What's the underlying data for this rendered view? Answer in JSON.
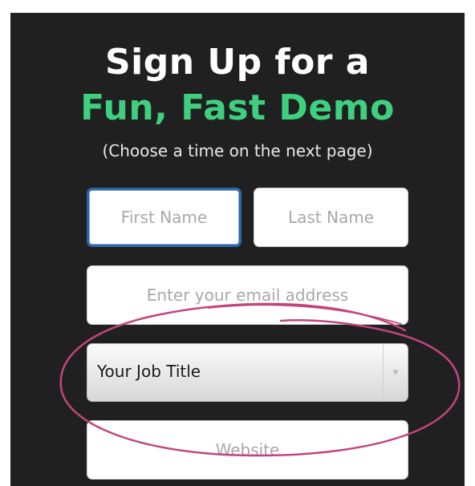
{
  "heading": {
    "line1": "Sign Up for a",
    "line2": "Fun, Fast Demo",
    "subtitle": "(Choose a time on the next page)"
  },
  "form": {
    "first_name_placeholder": "First Name",
    "last_name_placeholder": "Last Name",
    "email_placeholder": "Enter your email address",
    "job_title_selected": "Your Job Title",
    "website_placeholder": "Website"
  },
  "colors": {
    "accent_green": "#3ed07f",
    "background": "#202020",
    "focus_border": "#2d68a8",
    "annotation_pink": "#c2457a"
  }
}
